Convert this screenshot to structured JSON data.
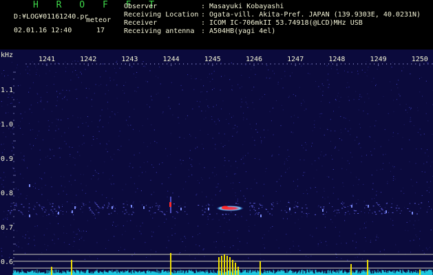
{
  "header": {
    "title": "H R O F F T",
    "file_path": "D:¥LOG¥01161240.pr",
    "mode": "meteor",
    "timestamp": "02.01.16 12:40",
    "count": "17",
    "info": [
      {
        "key": "Observer",
        "value": "Masayuki Kobayashi"
      },
      {
        "key": "Receiving Location",
        "value": "Ogata-vill. Akita-Pref. JAPAN (139.9303E, 40.0231N)"
      },
      {
        "key": "Receiver",
        "value": "ICOM IC-706mkII 53.74918(@LCD)MHz USB"
      },
      {
        "key": "Receiving antenna",
        "value": "A504HB(yagi 4el)"
      }
    ]
  },
  "plot": {
    "y_unit": "kHz",
    "x_ticks": [
      "1241",
      "1242",
      "1243",
      "1244",
      "1245",
      "1246",
      "1247",
      "1248",
      "1249",
      "1250"
    ],
    "y_ticks": [
      "1.1",
      "1.0",
      "0.9",
      "0.8",
      "0.7",
      "0.6"
    ],
    "colors": {
      "background": "#0b0a3c",
      "axis_text": "#f5f5d8",
      "spectrum_fill": "#1ec8e0",
      "spectrum_peak": "#f0e000",
      "echo_core": "#ff2a2a",
      "reference_line": "#d0d0c0"
    }
  }
}
